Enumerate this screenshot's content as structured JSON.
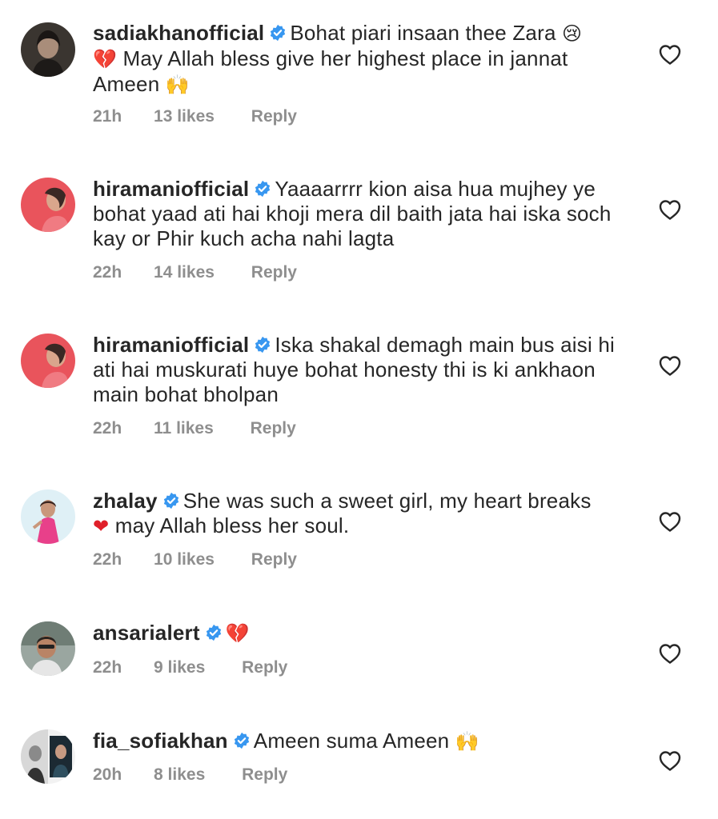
{
  "comments": [
    {
      "username": "sadiakhanofficial",
      "text_1": "Bohat piari insaan thee Zara ",
      "emoji_1": "😢",
      "emoji_2": "💔",
      "text_2": " May Allah bless give her highest place in jannat Ameen ",
      "emoji_3": "🙌",
      "time": "21h",
      "likes": "13 likes",
      "reply": "Reply"
    },
    {
      "username": "hiramaniofficial",
      "text_1": "Yaaaarrrr kion aisa hua mujhey ye bohat yaad ati hai khoji mera dil baith jata hai iska soch kay or Phir kuch acha nahi lagta",
      "time": "22h",
      "likes": "14 likes",
      "reply": "Reply"
    },
    {
      "username": "hiramaniofficial",
      "text_1": "Iska shakal demagh main bus aisi hi ati hai muskurati huye bohat honesty thi is ki ankhaon main bohat bholpan",
      "time": "22h",
      "likes": "11 likes",
      "reply": "Reply"
    },
    {
      "username": "zhalay",
      "text_1": "She was such a sweet girl, my heart breaks ",
      "emoji_1": "❤",
      "text_2": " may Allah bless her soul.",
      "time": "22h",
      "likes": "10 likes",
      "reply": "Reply"
    },
    {
      "username": "ansarialert",
      "emoji_1": "💔",
      "time": "22h",
      "likes": "9 likes",
      "reply": "Reply"
    },
    {
      "username": "fia_sofiakhan",
      "text_1": "Ameen suma Ameen ",
      "emoji_1": "🙌",
      "time": "20h",
      "likes": "8 likes",
      "reply": "Reply"
    }
  ],
  "colors": {
    "text": "#262626",
    "meta": "#8e8e8e",
    "verified": "#3897f0",
    "heart_outline": "#262626"
  }
}
